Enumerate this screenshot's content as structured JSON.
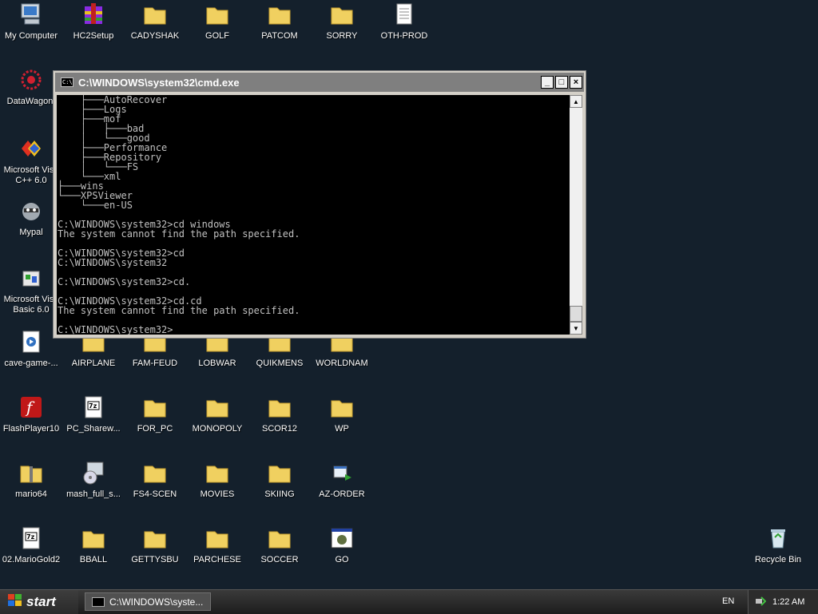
{
  "desktop": {
    "icons": [
      {
        "label": "My Computer"
      },
      {
        "label": "HC2Setup"
      },
      {
        "label": "CADYSHAK"
      },
      {
        "label": "GOLF"
      },
      {
        "label": "PATCOM"
      },
      {
        "label": "SORRY"
      },
      {
        "label": "OTH-PROD"
      },
      {
        "label": "DataWagon."
      },
      {
        "label": "Microsoft Visu C++ 6.0"
      },
      {
        "label": "Mypal"
      },
      {
        "label": "Microsoft Visu Basic 6.0"
      },
      {
        "label": "cave-game-..."
      },
      {
        "label": "AIRPLANE"
      },
      {
        "label": "FAM-FEUD"
      },
      {
        "label": "LOBWAR"
      },
      {
        "label": "QUIKMENS"
      },
      {
        "label": "WORLDNAM"
      },
      {
        "label": "FlashPlayer10"
      },
      {
        "label": "PC_Sharew..."
      },
      {
        "label": "FOR_PC"
      },
      {
        "label": "MONOPOLY"
      },
      {
        "label": "SCOR12"
      },
      {
        "label": "WP"
      },
      {
        "label": "mario64"
      },
      {
        "label": "mash_full_s..."
      },
      {
        "label": "FS4-SCEN"
      },
      {
        "label": "MOVIES"
      },
      {
        "label": "SKIING"
      },
      {
        "label": "AZ-ORDER"
      },
      {
        "label": "02.MarioGold2"
      },
      {
        "label": "BBALL"
      },
      {
        "label": "GETTYSBU"
      },
      {
        "label": "PARCHESE"
      },
      {
        "label": "SOCCER"
      },
      {
        "label": "GO"
      },
      {
        "label": "Recycle Bin"
      }
    ]
  },
  "cmd": {
    "title": "C:\\WINDOWS\\system32\\cmd.exe",
    "lines": [
      "    ├───AutoRecover",
      "    ├───Logs",
      "    ├───mof",
      "    │   ├───bad",
      "    │   └───good",
      "    ├───Performance",
      "    ├───Repository",
      "    │   └───FS",
      "    └───xml",
      "├───wins",
      "└───XPSViewer",
      "    └───en-US",
      "",
      "C:\\WINDOWS\\system32>cd windows",
      "The system cannot find the path specified.",
      "",
      "C:\\WINDOWS\\system32>cd",
      "C:\\WINDOWS\\system32",
      "",
      "C:\\WINDOWS\\system32>cd.",
      "",
      "C:\\WINDOWS\\system32>cd.cd",
      "The system cannot find the path specified.",
      "",
      "C:\\WINDOWS\\system32>"
    ],
    "minimize": "_",
    "maximize": "□",
    "close": "×"
  },
  "taskbar": {
    "start_label": "start",
    "task_label": "C:\\WINDOWS\\syste...",
    "language": "EN",
    "clock": "1:22 AM"
  }
}
